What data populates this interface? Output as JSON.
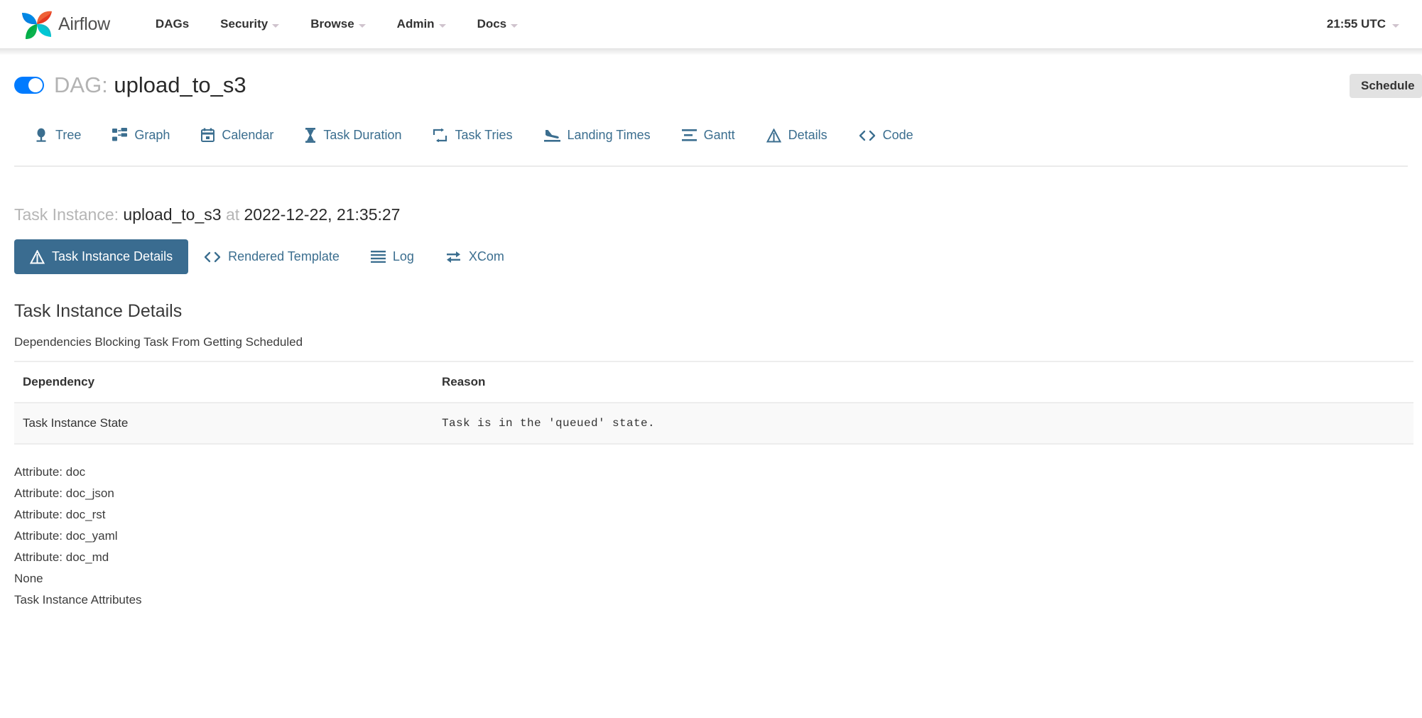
{
  "navbar": {
    "brand": "Airflow",
    "logo_icon": "airflow-pinwheel-icon",
    "links": [
      {
        "label": "DAGs",
        "has_caret": false
      },
      {
        "label": "Security",
        "has_caret": true
      },
      {
        "label": "Browse",
        "has_caret": true
      },
      {
        "label": "Admin",
        "has_caret": true
      },
      {
        "label": "Docs",
        "has_caret": true
      }
    ],
    "clock": "21:55 UTC",
    "clock_caret_icon": "chevron-down-icon"
  },
  "dag": {
    "toggle_state": "on",
    "prefix": "DAG:",
    "name": "upload_to_s3",
    "schedule_badge": "Schedule"
  },
  "dag_tabs": [
    {
      "label": "Tree",
      "icon": "tree-icon",
      "active": false
    },
    {
      "label": "Graph",
      "icon": "project-diagram-icon",
      "active": false
    },
    {
      "label": "Calendar",
      "icon": "calendar-icon",
      "active": false
    },
    {
      "label": "Task Duration",
      "icon": "hourglass-icon",
      "active": false
    },
    {
      "label": "Task Tries",
      "icon": "retry-arrows-icon",
      "active": false
    },
    {
      "label": "Landing Times",
      "icon": "plane-landing-icon",
      "active": false
    },
    {
      "label": "Gantt",
      "icon": "align-left-bars-icon",
      "active": false
    },
    {
      "label": "Details",
      "icon": "triangle-warning-icon",
      "active": false
    },
    {
      "label": "Code",
      "icon": "code-brackets-icon",
      "active": false
    }
  ],
  "task_instance": {
    "prefix": "Task Instance:",
    "name": "upload_to_s3",
    "at": "at",
    "timestamp": "2022-12-22, 21:35:27"
  },
  "ti_tabs": [
    {
      "label": "Task Instance Details",
      "icon": "triangle-warning-icon",
      "active": true
    },
    {
      "label": "Rendered Template",
      "icon": "code-brackets-icon",
      "active": false
    },
    {
      "label": "Log",
      "icon": "bars-icon",
      "active": false
    },
    {
      "label": "XCom",
      "icon": "exchange-arrows-icon",
      "active": false
    }
  ],
  "details": {
    "title": "Task Instance Details",
    "subtitle": "Dependencies Blocking Task From Getting Scheduled",
    "table": {
      "columns": [
        "Dependency",
        "Reason"
      ],
      "rows": [
        {
          "dependency": "Task Instance State",
          "reason": "Task is in the 'queued' state."
        }
      ]
    },
    "attributes": [
      "Attribute: doc",
      "Attribute: doc_json",
      "Attribute: doc_rst",
      "Attribute: doc_yaml",
      "Attribute: doc_md",
      "None",
      "Task Instance Attributes"
    ]
  },
  "colors": {
    "accent_blue": "#3a6c90",
    "toggle_on": "#007bff",
    "link_blue": "#3b6e8f",
    "row_bg": "#f9f9f9",
    "border": "#ededed",
    "badge_bg": "#e2e2e2"
  }
}
